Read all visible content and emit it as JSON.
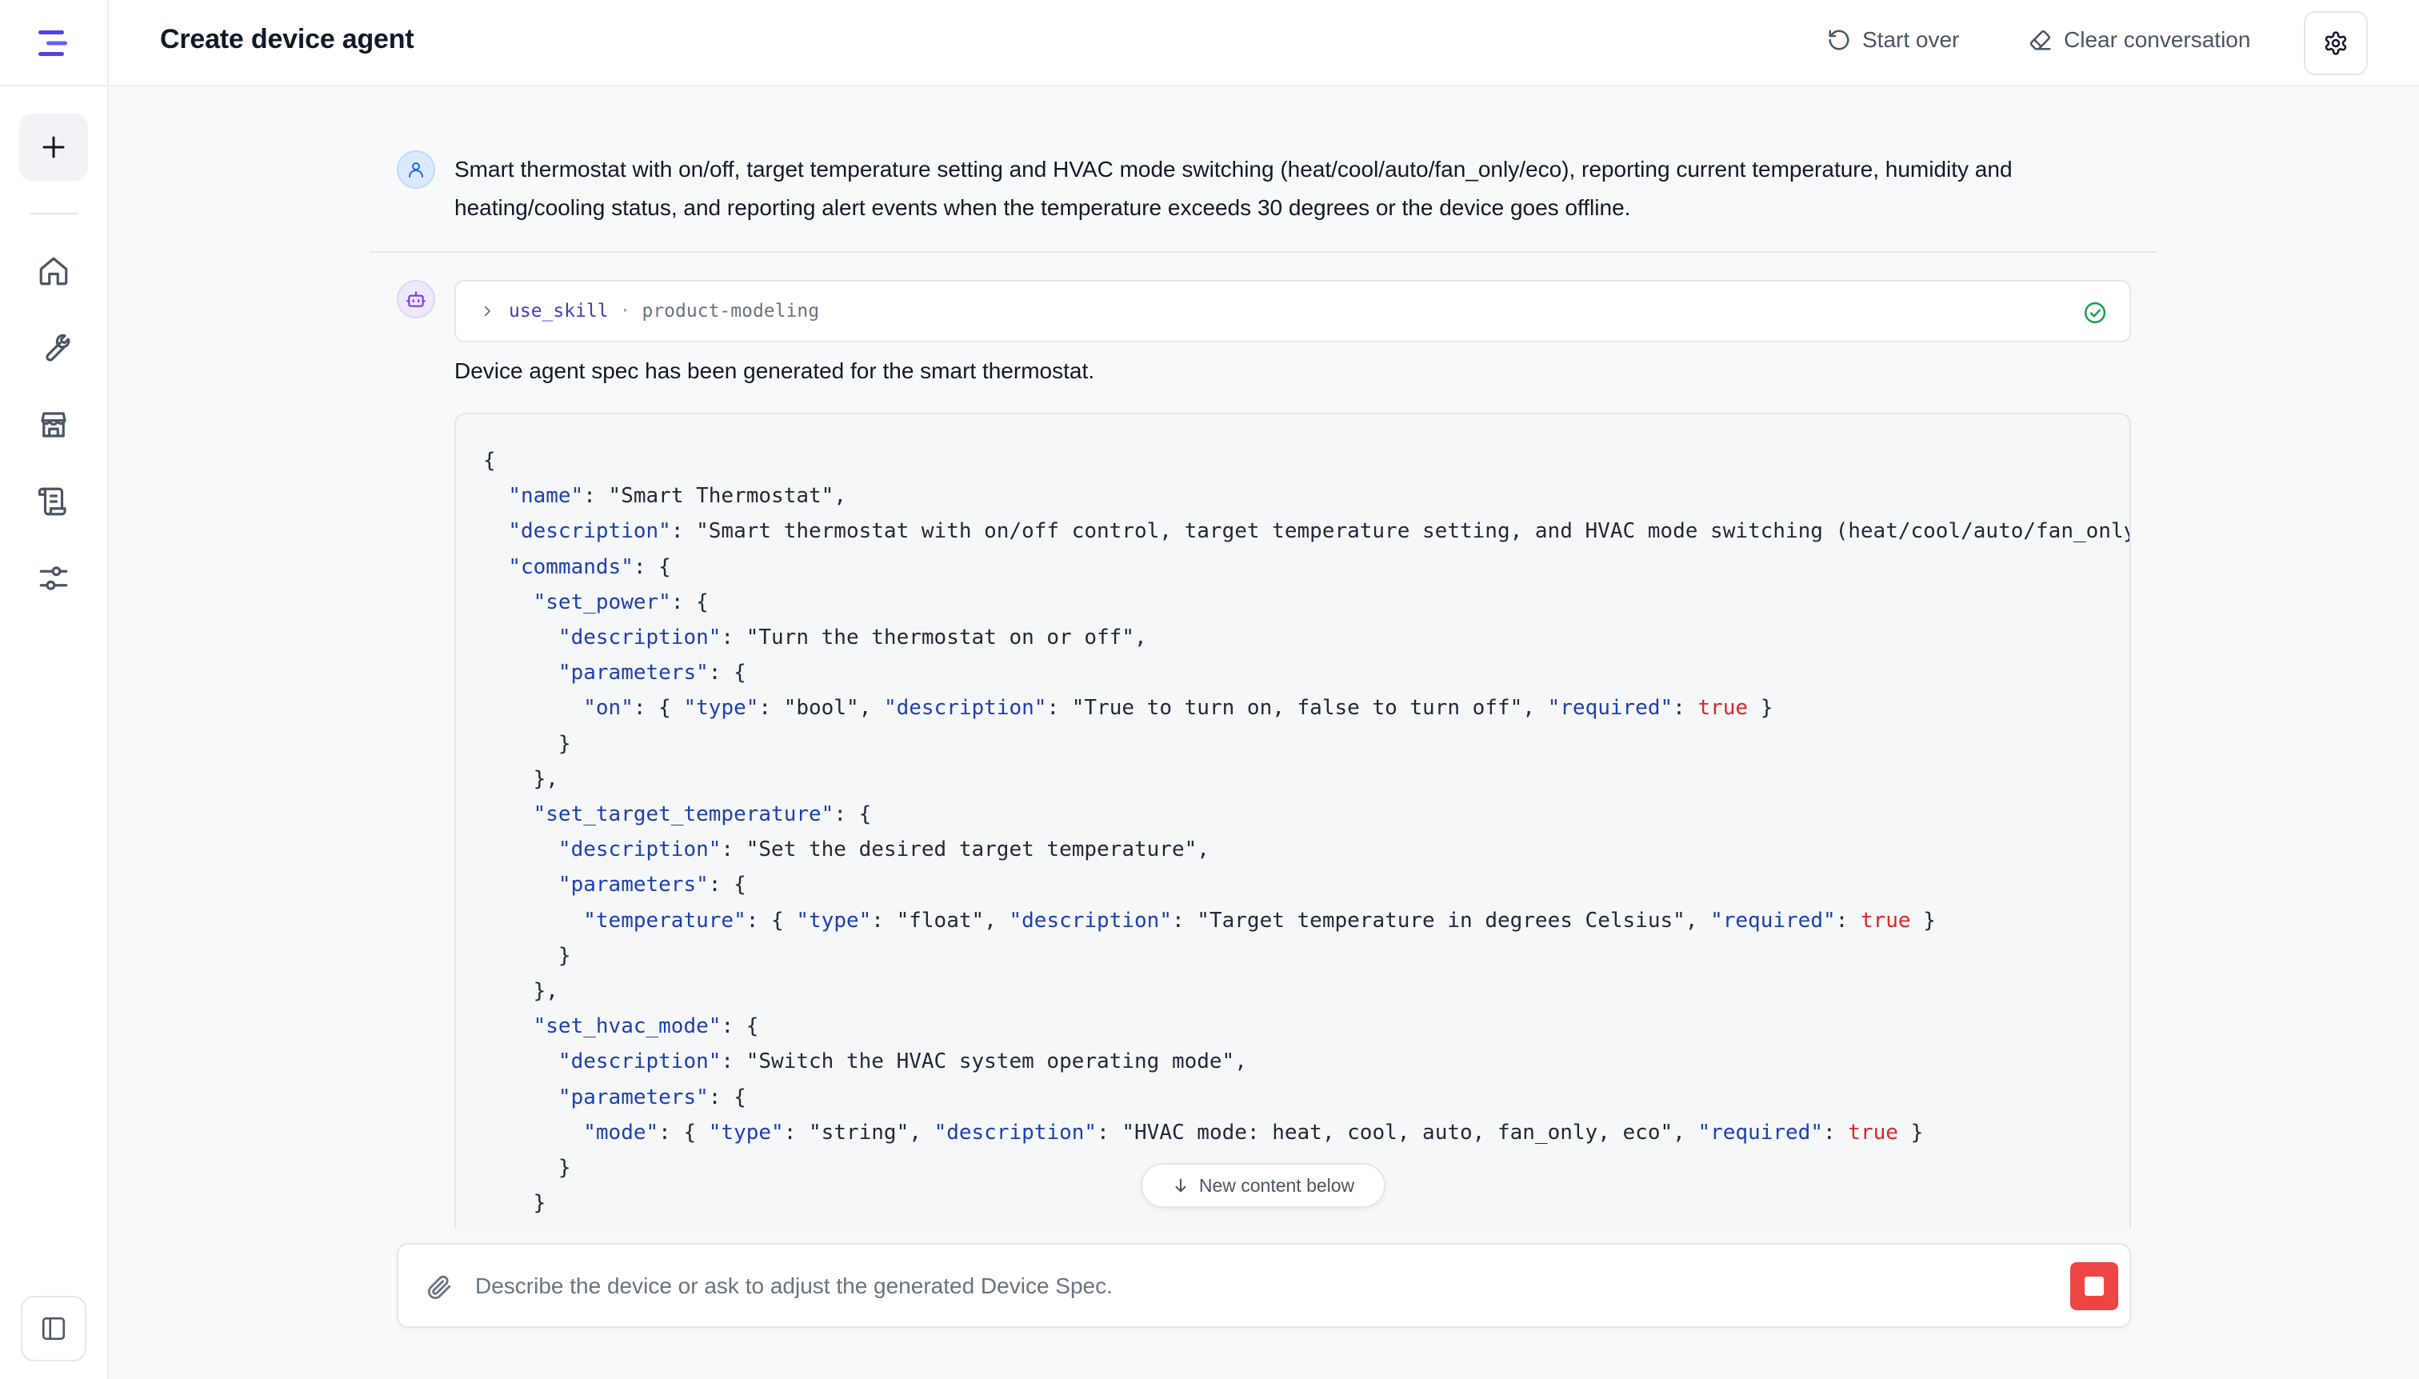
{
  "header": {
    "title": "Create device agent",
    "start_over": "Start over",
    "clear_conversation": "Clear conversation"
  },
  "sidebar": {
    "items": [
      {
        "icon": "home-icon"
      },
      {
        "icon": "wrench-icon"
      },
      {
        "icon": "store-icon"
      },
      {
        "icon": "scroll-icon"
      },
      {
        "icon": "sliders-icon"
      }
    ]
  },
  "chat": {
    "user_message": "Smart thermostat with on/off, target temperature setting and HVAC mode switching (heat/cool/auto/fan_only/eco), reporting current temperature, humidity and heating/cooling status, and reporting alert events when the temperature exceeds 30 degrees or the device goes offline.",
    "tool_call": {
      "name": "use_skill",
      "separator": "·",
      "skill": "product-modeling"
    },
    "bot_message": "Device agent spec has been generated for the smart thermostat.",
    "code_lines": [
      [
        {
          "t": "p",
          "v": "{"
        }
      ],
      [
        {
          "t": "p",
          "v": "  "
        },
        {
          "t": "k",
          "v": "\"name\""
        },
        {
          "t": "p",
          "v": ": "
        },
        {
          "t": "s",
          "v": "\"Smart Thermostat\""
        },
        {
          "t": "p",
          "v": ","
        }
      ],
      [
        {
          "t": "p",
          "v": "  "
        },
        {
          "t": "k",
          "v": "\"description\""
        },
        {
          "t": "p",
          "v": ": "
        },
        {
          "t": "s",
          "v": "\"Smart thermostat with on/off control, target temperature setting, and HVAC mode switching (heat/cool/auto/fan_only"
        }
      ],
      [
        {
          "t": "p",
          "v": "  "
        },
        {
          "t": "k",
          "v": "\"commands\""
        },
        {
          "t": "p",
          "v": ": {"
        }
      ],
      [
        {
          "t": "p",
          "v": "    "
        },
        {
          "t": "k",
          "v": "\"set_power\""
        },
        {
          "t": "p",
          "v": ": {"
        }
      ],
      [
        {
          "t": "p",
          "v": "      "
        },
        {
          "t": "k",
          "v": "\"description\""
        },
        {
          "t": "p",
          "v": ": "
        },
        {
          "t": "s",
          "v": "\"Turn the thermostat on or off\""
        },
        {
          "t": "p",
          "v": ","
        }
      ],
      [
        {
          "t": "p",
          "v": "      "
        },
        {
          "t": "k",
          "v": "\"parameters\""
        },
        {
          "t": "p",
          "v": ": {"
        }
      ],
      [
        {
          "t": "p",
          "v": "        "
        },
        {
          "t": "k",
          "v": "\"on\""
        },
        {
          "t": "p",
          "v": ": { "
        },
        {
          "t": "k",
          "v": "\"type\""
        },
        {
          "t": "p",
          "v": ": "
        },
        {
          "t": "s",
          "v": "\"bool\""
        },
        {
          "t": "p",
          "v": ", "
        },
        {
          "t": "k",
          "v": "\"description\""
        },
        {
          "t": "p",
          "v": ": "
        },
        {
          "t": "s",
          "v": "\"True to turn on, false to turn off\""
        },
        {
          "t": "p",
          "v": ", "
        },
        {
          "t": "k",
          "v": "\"required\""
        },
        {
          "t": "p",
          "v": ": "
        },
        {
          "t": "b",
          "v": "true"
        },
        {
          "t": "p",
          "v": " }"
        }
      ],
      [
        {
          "t": "p",
          "v": "      }"
        }
      ],
      [
        {
          "t": "p",
          "v": "    },"
        }
      ],
      [
        {
          "t": "p",
          "v": "    "
        },
        {
          "t": "k",
          "v": "\"set_target_temperature\""
        },
        {
          "t": "p",
          "v": ": {"
        }
      ],
      [
        {
          "t": "p",
          "v": "      "
        },
        {
          "t": "k",
          "v": "\"description\""
        },
        {
          "t": "p",
          "v": ": "
        },
        {
          "t": "s",
          "v": "\"Set the desired target temperature\""
        },
        {
          "t": "p",
          "v": ","
        }
      ],
      [
        {
          "t": "p",
          "v": "      "
        },
        {
          "t": "k",
          "v": "\"parameters\""
        },
        {
          "t": "p",
          "v": ": {"
        }
      ],
      [
        {
          "t": "p",
          "v": "        "
        },
        {
          "t": "k",
          "v": "\"temperature\""
        },
        {
          "t": "p",
          "v": ": { "
        },
        {
          "t": "k",
          "v": "\"type\""
        },
        {
          "t": "p",
          "v": ": "
        },
        {
          "t": "s",
          "v": "\"float\""
        },
        {
          "t": "p",
          "v": ", "
        },
        {
          "t": "k",
          "v": "\"description\""
        },
        {
          "t": "p",
          "v": ": "
        },
        {
          "t": "s",
          "v": "\"Target temperature in degrees Celsius\""
        },
        {
          "t": "p",
          "v": ", "
        },
        {
          "t": "k",
          "v": "\"required\""
        },
        {
          "t": "p",
          "v": ": "
        },
        {
          "t": "b",
          "v": "true"
        },
        {
          "t": "p",
          "v": " }"
        }
      ],
      [
        {
          "t": "p",
          "v": "      }"
        }
      ],
      [
        {
          "t": "p",
          "v": "    },"
        }
      ],
      [
        {
          "t": "p",
          "v": "    "
        },
        {
          "t": "k",
          "v": "\"set_hvac_mode\""
        },
        {
          "t": "p",
          "v": ": {"
        }
      ],
      [
        {
          "t": "p",
          "v": "      "
        },
        {
          "t": "k",
          "v": "\"description\""
        },
        {
          "t": "p",
          "v": ": "
        },
        {
          "t": "s",
          "v": "\"Switch the HVAC system operating mode\""
        },
        {
          "t": "p",
          "v": ","
        }
      ],
      [
        {
          "t": "p",
          "v": "      "
        },
        {
          "t": "k",
          "v": "\"parameters\""
        },
        {
          "t": "p",
          "v": ": {"
        }
      ],
      [
        {
          "t": "p",
          "v": "        "
        },
        {
          "t": "k",
          "v": "\"mode\""
        },
        {
          "t": "p",
          "v": ": { "
        },
        {
          "t": "k",
          "v": "\"type\""
        },
        {
          "t": "p",
          "v": ": "
        },
        {
          "t": "s",
          "v": "\"string\""
        },
        {
          "t": "p",
          "v": ", "
        },
        {
          "t": "k",
          "v": "\"description\""
        },
        {
          "t": "p",
          "v": ": "
        },
        {
          "t": "s",
          "v": "\"HVAC mode: heat, cool, auto, fan_only, eco\""
        },
        {
          "t": "p",
          "v": ", "
        },
        {
          "t": "k",
          "v": "\"required\""
        },
        {
          "t": "p",
          "v": ": "
        },
        {
          "t": "b",
          "v": "true"
        },
        {
          "t": "p",
          "v": " }"
        }
      ],
      [
        {
          "t": "p",
          "v": "      }"
        }
      ],
      [
        {
          "t": "p",
          "v": "    }"
        }
      ],
      [
        {
          "t": "p",
          "v": "  },"
        }
      ]
    ],
    "new_content_label": "New content below"
  },
  "composer": {
    "placeholder": "Describe the device or ask to adjust the generated Device Spec."
  },
  "colors": {
    "accent": "#4f46e5",
    "stop": "#ef4444",
    "code_key": "#1e40af",
    "code_bool": "#dc2626",
    "success": "#16a34a"
  }
}
